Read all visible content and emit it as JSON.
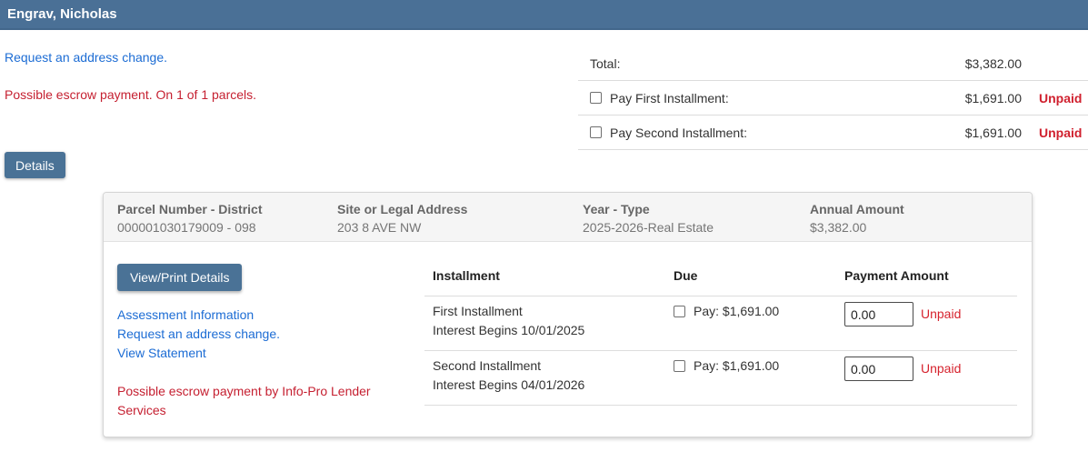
{
  "header": {
    "title": "Engrav, Nicholas"
  },
  "top": {
    "address_change_link": "Request an address change.",
    "escrow_notice": "Possible escrow payment. On 1 of 1 parcels.",
    "details_button": "Details"
  },
  "summary": {
    "total_label": "Total:",
    "total_amount": "$3,382.00",
    "rows": [
      {
        "label": "Pay First Installment:",
        "amount": "$1,691.00",
        "status": "Unpaid"
      },
      {
        "label": "Pay Second Installment:",
        "amount": "$1,691.00",
        "status": "Unpaid"
      }
    ]
  },
  "parcel": {
    "header_columns": [
      {
        "label": "Parcel Number - District",
        "value": "000001030179009 - 098"
      },
      {
        "label": "Site or Legal Address",
        "value": "203 8 AVE NW"
      },
      {
        "label": "Year - Type",
        "value": "2025-2026-Real Estate"
      },
      {
        "label": "Annual Amount",
        "value": "$3,382.00"
      }
    ],
    "view_print_button": "View/Print Details",
    "links": [
      "Assessment Information",
      "Request an address change.",
      "View Statement"
    ],
    "escrow_notice": "Possible escrow payment by Info-Pro Lender Services",
    "table": {
      "headers": [
        "Installment",
        "Due",
        "Payment Amount"
      ],
      "rows": [
        {
          "name": "First Installment",
          "interest": "Interest Begins 10/01/2025",
          "due": "Pay: $1,691.00",
          "payment_value": "0.00",
          "status": "Unpaid"
        },
        {
          "name": "Second Installment",
          "interest": "Interest Begins 04/01/2026",
          "due": "Pay: $1,691.00",
          "payment_value": "0.00",
          "status": "Unpaid"
        }
      ]
    }
  },
  "colors": {
    "accent_blue": "#4a7096",
    "link_blue": "#1c6cd4",
    "notice_red": "#c51f30",
    "unpaid_red": "#d0202e",
    "panel_header_gray": "#f5f5f5",
    "divider_gray": "#dcdcdc"
  }
}
